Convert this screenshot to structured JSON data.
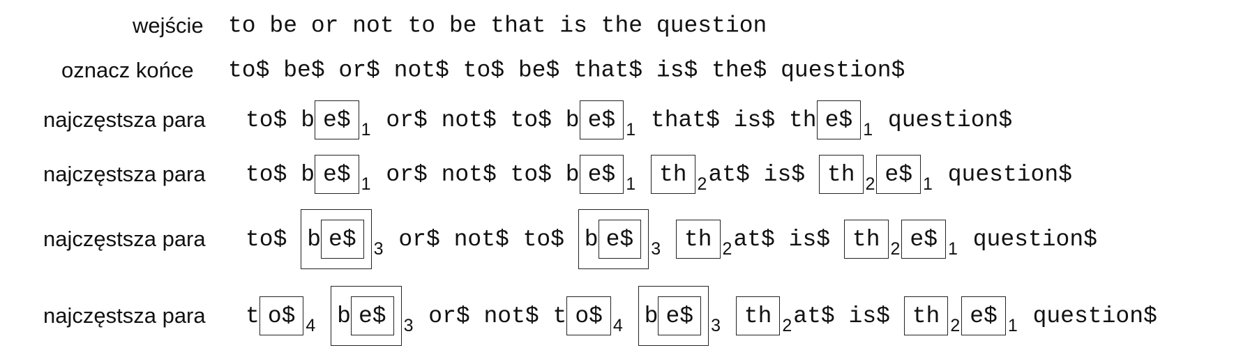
{
  "rows": [
    {
      "label": "wejście",
      "items": [
        {
          "text": "to be or not to be that is the question"
        }
      ]
    },
    {
      "label": "oznacz końce",
      "items": [
        {
          "text": "to$ be$ or$ not$ to$ be$ that$ is$ the$ question$"
        }
      ]
    },
    {
      "label": "najczęstsza para",
      "items": [
        {
          "text": "to$ b"
        },
        {
          "box": [
            {
              "text": "e$"
            }
          ],
          "sub": "1"
        },
        {
          "text": " or$ not$ to$ b"
        },
        {
          "box": [
            {
              "text": "e$"
            }
          ],
          "sub": "1"
        },
        {
          "text": " that$ is$ th"
        },
        {
          "box": [
            {
              "text": "e$"
            }
          ],
          "sub": "1"
        },
        {
          "text": " question$"
        }
      ]
    },
    {
      "label": "najczęstsza para",
      "items": [
        {
          "text": "to$ b"
        },
        {
          "box": [
            {
              "text": "e$"
            }
          ],
          "sub": "1"
        },
        {
          "text": " or$ not$ to$ b"
        },
        {
          "box": [
            {
              "text": "e$"
            }
          ],
          "sub": "1"
        },
        {
          "text": " "
        },
        {
          "box": [
            {
              "text": "th"
            }
          ],
          "sub": "2"
        },
        {
          "text": "at$ is$ "
        },
        {
          "box": [
            {
              "text": "th"
            }
          ],
          "sub": "2"
        },
        {
          "box": [
            {
              "text": "e$"
            }
          ],
          "sub": "1"
        },
        {
          "text": " question$"
        }
      ]
    },
    {
      "label": "najczęstsza para",
      "items": [
        {
          "text": "to$ "
        },
        {
          "box": [
            {
              "text": "b"
            },
            {
              "box": [
                {
                  "text": "e$"
                }
              ]
            }
          ],
          "sub": "3"
        },
        {
          "text": " or$ not$ to$ "
        },
        {
          "box": [
            {
              "text": "b"
            },
            {
              "box": [
                {
                  "text": "e$"
                }
              ]
            }
          ],
          "sub": "3"
        },
        {
          "text": " "
        },
        {
          "box": [
            {
              "text": "th"
            }
          ],
          "sub": "2"
        },
        {
          "text": "at$ is$ "
        },
        {
          "box": [
            {
              "text": "th"
            }
          ],
          "sub": "2"
        },
        {
          "box": [
            {
              "text": "e$"
            }
          ],
          "sub": "1"
        },
        {
          "text": " question$"
        }
      ]
    },
    {
      "label": "najczęstsza para",
      "items": [
        {
          "text": "t"
        },
        {
          "box": [
            {
              "text": "o$"
            }
          ],
          "sub": "4"
        },
        {
          "text": " "
        },
        {
          "box": [
            {
              "text": "b"
            },
            {
              "box": [
                {
                  "text": "e$"
                }
              ]
            }
          ],
          "sub": "3"
        },
        {
          "text": " or$ not$ t"
        },
        {
          "box": [
            {
              "text": "o$"
            }
          ],
          "sub": "4"
        },
        {
          "text": " "
        },
        {
          "box": [
            {
              "text": "b"
            },
            {
              "box": [
                {
                  "text": "e$"
                }
              ]
            }
          ],
          "sub": "3"
        },
        {
          "text": " "
        },
        {
          "box": [
            {
              "text": "th"
            }
          ],
          "sub": "2"
        },
        {
          "text": "at$ is$ "
        },
        {
          "box": [
            {
              "text": "th"
            }
          ],
          "sub": "2"
        },
        {
          "box": [
            {
              "text": "e$"
            }
          ],
          "sub": "1"
        },
        {
          "text": " question$"
        }
      ]
    }
  ]
}
